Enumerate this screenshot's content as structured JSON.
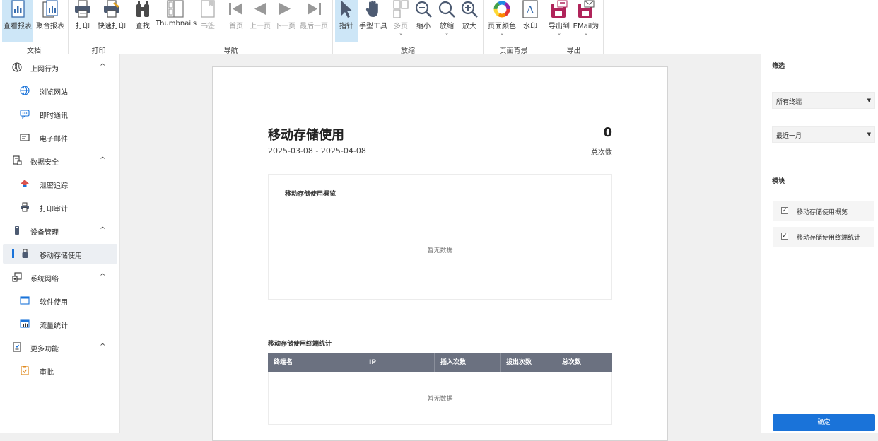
{
  "ribbon": {
    "groups": {
      "document": "文档",
      "print": "打印",
      "navigation": "导航",
      "zoom": "放缩",
      "page_background": "页面背景",
      "export": "导出"
    },
    "buttons": {
      "view_report": "查看报表",
      "aggregate_report": "聚合报表",
      "print": "打印",
      "quick_print": "快速打印",
      "find": "查找",
      "thumbnails": "Thumbnails",
      "bookmarks": "书签",
      "first_page": "首页",
      "prev_page": "上一页",
      "next_page": "下一页",
      "last_page": "最后一页",
      "pointer": "指针",
      "hand_tool": "手型工具",
      "multi_page": "多页",
      "zoom_out": "缩小",
      "zoom": "放缩",
      "zoom_in": "放大",
      "page_color": "页面颜色",
      "watermark": "水印",
      "export_to": "导出到",
      "email_as": "EMail为"
    }
  },
  "sidebar": {
    "groups": [
      {
        "label": "上网行为",
        "items": [
          "浏览网站",
          "即时通讯",
          "电子邮件"
        ]
      },
      {
        "label": "数据安全",
        "items": [
          "泄密追踪",
          "打印审计"
        ]
      },
      {
        "label": "设备管理",
        "items": [
          "移动存储使用"
        ]
      },
      {
        "label": "系统网络",
        "items": [
          "软件使用",
          "流量统计"
        ]
      },
      {
        "label": "更多功能",
        "items": [
          "审批"
        ]
      }
    ],
    "active_item": "移动存储使用",
    "collapse_glyph": "^"
  },
  "report": {
    "title": "移动存储使用",
    "date_range": "2025-03-08 - 2025-04-08",
    "total_value": "0",
    "total_label": "总次数",
    "overview_title": "移动存储使用概览",
    "overview_empty": "暂无数据",
    "table_title": "移动存储使用终端统计",
    "table_columns": [
      "终端名",
      "IP",
      "插入次数",
      "拔出次数",
      "总次数"
    ],
    "table_empty": "暂无数据"
  },
  "filter_panel": {
    "filter_heading": "筛选",
    "terminal_select": "所有终端",
    "period_select": "最近一月",
    "modules_heading": "模块",
    "modules": [
      {
        "label": "移动存储使用概览",
        "checked": true
      },
      {
        "label": "移动存储使用终端统计",
        "checked": true
      }
    ],
    "confirm_button": "确定"
  },
  "colors": {
    "accent": "#1a73d9",
    "table_header": "#6b7180",
    "active_tab": "#cde6f7"
  }
}
